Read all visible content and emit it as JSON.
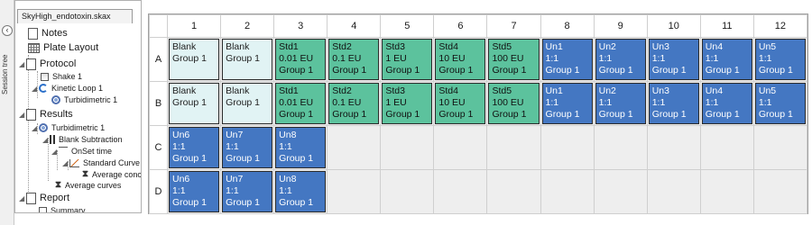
{
  "session": {
    "strip_label": "Session tree",
    "collapse_icon": "chevron-left-icon"
  },
  "document": {
    "tab_label": "SkyHigh_endotoxin.skax"
  },
  "tree": {
    "notes": "Notes",
    "plate_layout": "Plate Layout",
    "protocol": "Protocol",
    "shake": "Shake 1",
    "kinetic_loop": "Kinetic Loop 1",
    "turbidimetric_step": "Turbidimetric 1",
    "results": "Results",
    "turbidimetric_result": "Turbidimetric 1",
    "blank_subtraction": "Blank Subtraction",
    "onset_time": "OnSet time",
    "standard_curve": "Standard Curve",
    "average_conc": "Average conc.",
    "average_curves": "Average curves",
    "report": "Report",
    "summary": "Summary",
    "selection_color": "#0078d7"
  },
  "plate": {
    "columns": [
      "1",
      "2",
      "3",
      "4",
      "5",
      "6",
      "7",
      "8",
      "9",
      "10",
      "11",
      "12"
    ],
    "rows": [
      "A",
      "B",
      "C",
      "D"
    ],
    "colors": {
      "blank": "#e1f3f4",
      "standard": "#5cc29d",
      "unknown": "#4477c2",
      "empty": "#eeeeee"
    },
    "wells": {
      "A": [
        {
          "type": "blank",
          "lines": [
            "Blank",
            "Group 1"
          ]
        },
        {
          "type": "blank",
          "lines": [
            "Blank",
            "Group 1"
          ]
        },
        {
          "type": "std",
          "lines": [
            "Std1",
            "0.01 EU",
            "Group 1"
          ]
        },
        {
          "type": "std",
          "lines": [
            "Std2",
            "0.1 EU",
            "Group 1"
          ]
        },
        {
          "type": "std",
          "lines": [
            "Std3",
            "1 EU",
            "Group 1"
          ]
        },
        {
          "type": "std",
          "lines": [
            "Std4",
            "10 EU",
            "Group 1"
          ]
        },
        {
          "type": "std",
          "lines": [
            "Std5",
            "100 EU",
            "Group 1"
          ]
        },
        {
          "type": "un",
          "lines": [
            "Un1",
            "1:1",
            "Group 1"
          ]
        },
        {
          "type": "un",
          "lines": [
            "Un2",
            "1:1",
            "Group 1"
          ]
        },
        {
          "type": "un",
          "lines": [
            "Un3",
            "1:1",
            "Group 1"
          ]
        },
        {
          "type": "un",
          "lines": [
            "Un4",
            "1:1",
            "Group 1"
          ]
        },
        {
          "type": "un",
          "lines": [
            "Un5",
            "1:1",
            "Group 1"
          ]
        }
      ],
      "B": [
        {
          "type": "blank",
          "lines": [
            "Blank",
            "Group 1"
          ]
        },
        {
          "type": "blank",
          "lines": [
            "Blank",
            "Group 1"
          ]
        },
        {
          "type": "std",
          "lines": [
            "Std1",
            "0.01 EU",
            "Group 1"
          ]
        },
        {
          "type": "std",
          "lines": [
            "Std2",
            "0.1 EU",
            "Group 1"
          ]
        },
        {
          "type": "std",
          "lines": [
            "Std3",
            "1 EU",
            "Group 1"
          ]
        },
        {
          "type": "std",
          "lines": [
            "Std4",
            "10 EU",
            "Group 1"
          ]
        },
        {
          "type": "std",
          "lines": [
            "Std5",
            "100 EU",
            "Group 1"
          ]
        },
        {
          "type": "un",
          "lines": [
            "Un1",
            "1:1",
            "Group 1"
          ]
        },
        {
          "type": "un",
          "lines": [
            "Un2",
            "1:1",
            "Group 1"
          ]
        },
        {
          "type": "un",
          "lines": [
            "Un3",
            "1:1",
            "Group 1"
          ]
        },
        {
          "type": "un",
          "lines": [
            "Un4",
            "1:1",
            "Group 1"
          ]
        },
        {
          "type": "un",
          "lines": [
            "Un5",
            "1:1",
            "Group 1"
          ]
        }
      ],
      "C": [
        {
          "type": "un",
          "lines": [
            "Un6",
            "1:1",
            "Group 1"
          ]
        },
        {
          "type": "un",
          "lines": [
            "Un7",
            "1:1",
            "Group 1"
          ]
        },
        {
          "type": "un",
          "lines": [
            "Un8",
            "1:1",
            "Group 1"
          ]
        },
        null,
        null,
        null,
        null,
        null,
        null,
        null,
        null,
        null
      ],
      "D": [
        {
          "type": "un",
          "lines": [
            "Un6",
            "1:1",
            "Group 1"
          ]
        },
        {
          "type": "un",
          "lines": [
            "Un7",
            "1:1",
            "Group 1"
          ]
        },
        {
          "type": "un",
          "lines": [
            "Un8",
            "1:1",
            "Group 1"
          ]
        },
        null,
        null,
        null,
        null,
        null,
        null,
        null,
        null,
        null
      ]
    }
  }
}
